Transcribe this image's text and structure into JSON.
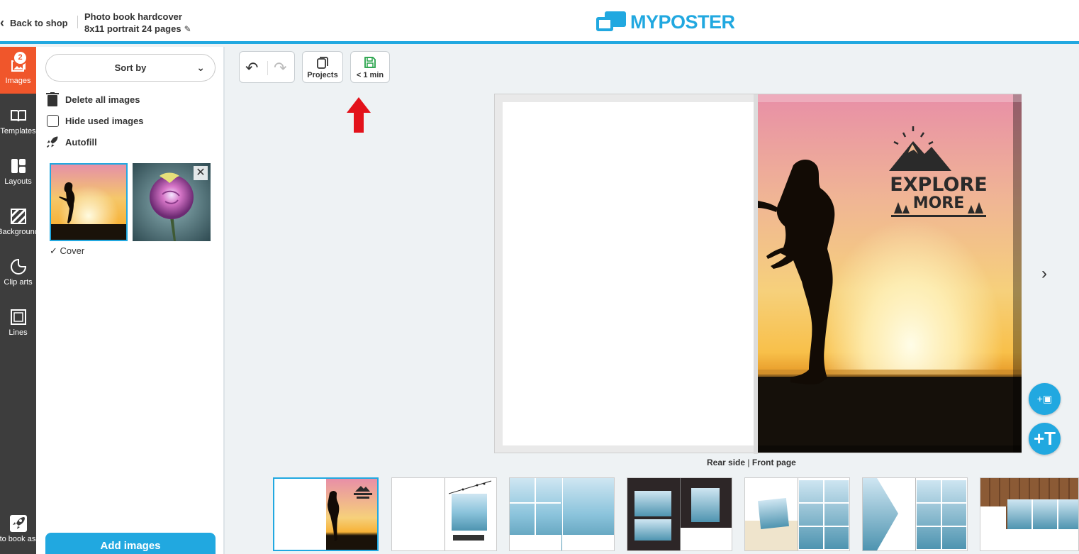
{
  "header": {
    "back_label": "Back to shop",
    "product_line1": "Photo book hardcover",
    "product_line2": "8x11 portrait 24 pages",
    "logo_text": "MYPOSTER",
    "brand_color": "#21a8e0"
  },
  "rail": {
    "items": [
      {
        "label": "Images",
        "icon": "images-icon",
        "badge": "2"
      },
      {
        "label": "Templates",
        "icon": "book-icon"
      },
      {
        "label": "Layouts",
        "icon": "layout-icon"
      },
      {
        "label": "Background",
        "icon": "background-icon"
      },
      {
        "label": "Clip arts",
        "icon": "clipart-icon"
      },
      {
        "label": "Lines",
        "icon": "frame-icon"
      },
      {
        "label": "Photo book assistant",
        "icon": "rocket-icon"
      }
    ],
    "active_color": "#f0562b"
  },
  "panel": {
    "sort_label": "Sort by",
    "delete_all_label": "Delete all images",
    "hide_used_label": "Hide used images",
    "autofill_label": "Autofill",
    "cover_tag": "Cover",
    "add_images_label": "Add images",
    "images": [
      {
        "name": "sunset silhouette",
        "used": true
      },
      {
        "name": "rose",
        "used": false
      }
    ]
  },
  "toolbar": {
    "projects_label": "Projects",
    "save_label": "< 1 min"
  },
  "canvas": {
    "cover_text_line1": "EXPLORE",
    "cover_text_line2": "MORE",
    "spread_label_left": "Rear side",
    "spread_label_sep": "|",
    "spread_label_right": "Front page"
  }
}
